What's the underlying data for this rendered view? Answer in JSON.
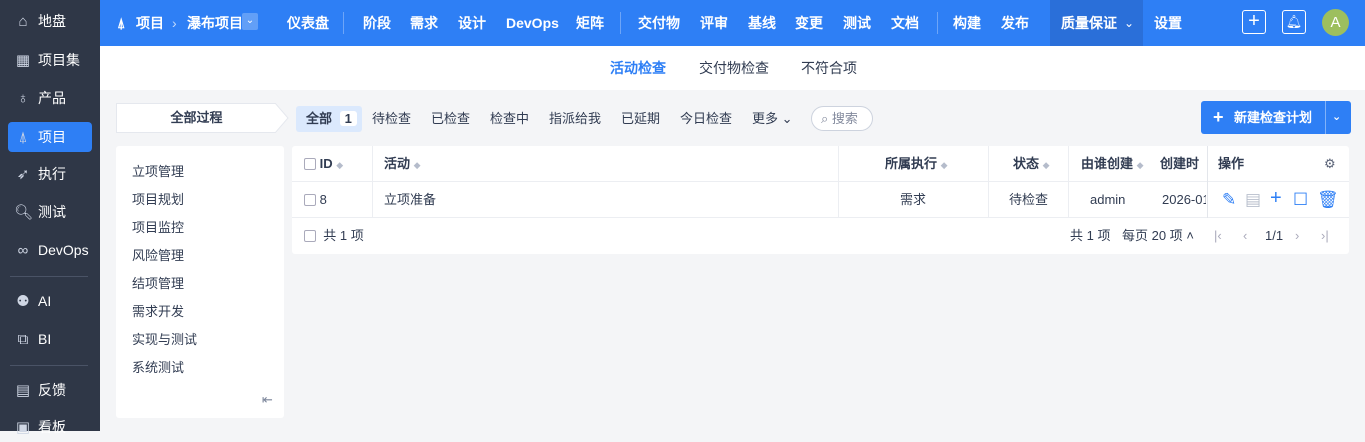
{
  "sidebar": {
    "items": [
      {
        "label": "地盘",
        "icon": "home-icon"
      },
      {
        "label": "项目集",
        "icon": "grid-icon"
      },
      {
        "label": "产品",
        "icon": "bulb-icon"
      },
      {
        "label": "项目",
        "icon": "rocket-icon"
      },
      {
        "label": "执行",
        "icon": "run-icon"
      },
      {
        "label": "测试",
        "icon": "search-icon"
      },
      {
        "label": "DevOps",
        "icon": "infinity-icon"
      },
      {
        "label": "AI",
        "icon": "robot-icon"
      },
      {
        "label": "BI",
        "icon": "chart-icon"
      },
      {
        "label": "反馈",
        "icon": "feedback-icon"
      },
      {
        "label": "看板",
        "icon": "board-icon"
      }
    ]
  },
  "topnav": {
    "breadcrumb_root": "项目",
    "breadcrumb_current": "瀑布项目",
    "items": [
      "仪表盘",
      "阶段",
      "需求",
      "设计",
      "DevOps",
      "矩阵",
      "交付物",
      "评审",
      "基线",
      "变更",
      "测试",
      "文档",
      "构建",
      "发布",
      "质量保证",
      "设置"
    ],
    "avatar": "A"
  },
  "subnav": [
    "活动检查",
    "交付物检查",
    "不符合项"
  ],
  "process": {
    "header": "全部过程",
    "items": [
      "立项管理",
      "项目规划",
      "项目监控",
      "风险管理",
      "结项管理",
      "需求开发",
      "实现与测试",
      "系统测试"
    ]
  },
  "filters": {
    "all": "全部",
    "all_count": "1",
    "items": [
      "待检查",
      "已检查",
      "检查中",
      "指派给我",
      "已延期",
      "今日检查"
    ],
    "more": "更多",
    "search_placeholder": "搜索",
    "new_button": "新建检查计划"
  },
  "table": {
    "headers": [
      "ID",
      "活动",
      "所属执行",
      "状态",
      "由谁创建",
      "创建时",
      "操作"
    ],
    "rows": [
      {
        "id": "8",
        "activity": "立项准备",
        "execution": "需求",
        "status": "待检查",
        "creator": "admin",
        "created": "2026-01"
      }
    ],
    "footer_total": "共 1 项",
    "pager_total": "共 1 项",
    "per_page": "每页 20 项",
    "page": "1/1"
  }
}
